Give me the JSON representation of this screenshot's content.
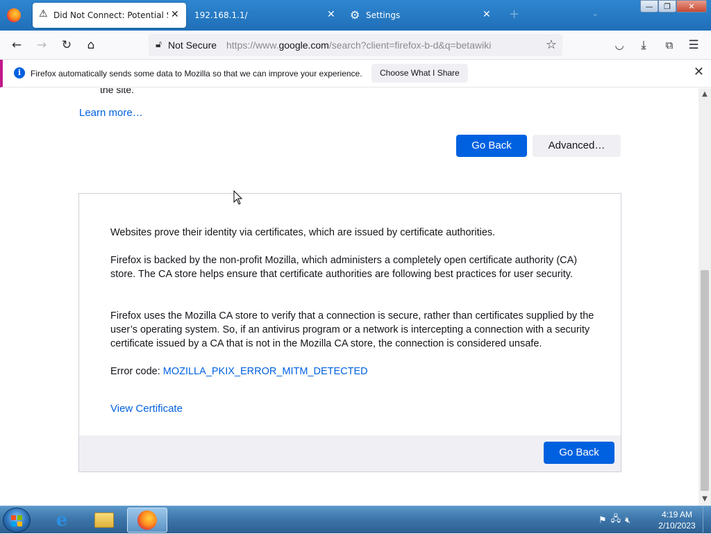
{
  "browser": {
    "tabs": [
      {
        "title": "Did Not Connect: Potential Sec",
        "active": true,
        "icon": "warning-icon"
      },
      {
        "title": "192.168.1.1/",
        "active": false,
        "icon": ""
      },
      {
        "title": "Settings",
        "active": false,
        "icon": "gear-icon"
      }
    ],
    "new_tab_symbol": "+",
    "window_controls": {
      "minimize": "—",
      "restore": "❐",
      "close": "✕"
    },
    "urlbar": {
      "security_label": "Not Secure",
      "url_prefix": "https://www.",
      "url_domain": "google.com",
      "url_suffix": "/search?client=firefox-b-d&q=betawiki"
    },
    "notification": {
      "message": "Firefox automatically sends some data to Mozilla so that we can improve your experience.",
      "button": "Choose What I Share"
    }
  },
  "page": {
    "cut_text": "the site.",
    "learn_more": "Learn more…",
    "go_back": "Go Back",
    "advanced": "Advanced…",
    "advanced_panel": {
      "p1": "Websites prove their identity via certificates, which are issued by certificate authorities.",
      "p2": "Firefox is backed by the non-profit Mozilla, which administers a completely open certificate authority (CA) store. The CA store helps ensure that certificate authorities are following best practices for user security.",
      "p3": "Firefox uses the Mozilla CA store to verify that a connection is secure, rather than certificates supplied by the user’s operating system. So, if an antivirus program or a network is intercepting a connection with a security certificate issued by a CA that is not in the Mozilla CA store, the connection is considered unsafe.",
      "error_label": "Error code: ",
      "error_code": "MOZILLA_PKIX_ERROR_MITM_DETECTED",
      "view_certificate": "View Certificate",
      "go_back": "Go Back"
    }
  },
  "taskbar": {
    "clock_time": "4:19 AM",
    "clock_date": "2/10/2023",
    "items": [
      "internet-explorer",
      "windows-explorer",
      "firefox"
    ]
  },
  "colors": {
    "accent": "#0061e0",
    "notification_border": "#c0188a",
    "taskbar": "#3e77ab"
  }
}
